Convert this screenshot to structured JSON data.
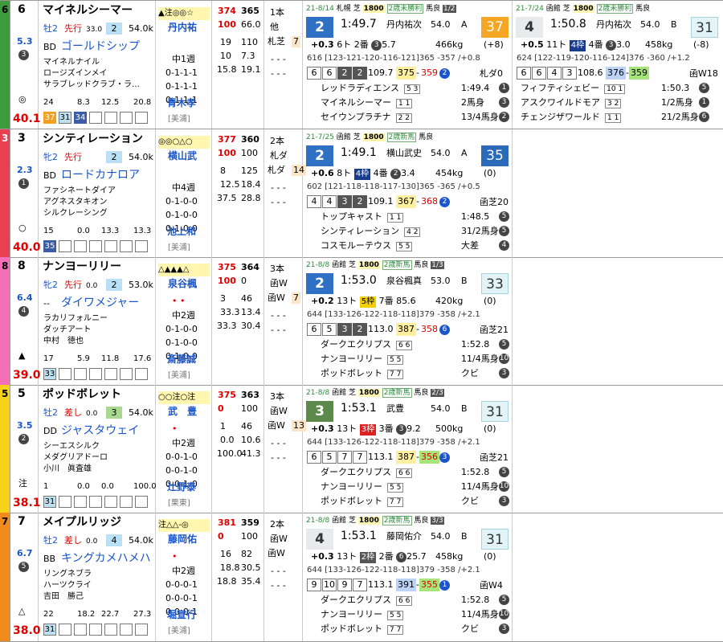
{
  "horses": [
    {
      "gate": "6",
      "gate_color": "#3d9b3d",
      "gate_text_color": "#000",
      "num": "6",
      "name": "マイネルシーマー",
      "sex": "牡2",
      "style": "先行",
      "style_val": "33.0",
      "pop": "2",
      "wt": "54.0k",
      "odds": "5.3",
      "pop_rank": "3",
      "bms_code": "BD",
      "sire": "ゴールドシップ",
      "dam": "マイネルナイル",
      "damsire": "ロージズインメイ",
      "owner": "サラブレッドクラブ・ラ…",
      "breeder": "",
      "mark": "◎",
      "score": "40.1",
      "pct1": "24",
      "pct2": "8.3",
      "pct3": "12.5",
      "pct4": "20.8",
      "past_pos": [
        "37",
        "31",
        "34",
        "",
        "",
        "",
        ""
      ],
      "marks": "▲注◎◎☆",
      "jockey": "丹内祐",
      "mid_dots": "",
      "rot": "中1週",
      "rec1": "0-1-1-1",
      "rec2": "0-1-1-1",
      "rec3": "0-1-1-1",
      "trainer": "青木孝",
      "stable": "[美浦]",
      "s1": "374",
      "s2": "365",
      "s3": "100",
      "s4": "66.0",
      "s5": "19",
      "s6": "110",
      "s7": "10",
      "s8": "7.3",
      "s9": "15.8",
      "s10": "19.1",
      "d1": "1本",
      "d2": "他",
      "d3": "札芝",
      "d4": "7",
      "d5": "- - -",
      "d6": "- - -",
      "races": [
        {
          "date": "21-8/14",
          "track": "札幌",
          "surf": "芝",
          "dist": "1800",
          "cls": "2歳未勝利",
          "cond": "馬良",
          "nn": "1/2",
          "rank": "2",
          "rank_style": "g",
          "time": "1:49.7",
          "jockey": "丹内祐次",
          "kg": "54.0",
          "grade": "A",
          "idx": "37",
          "idx_style": "or",
          "diff": "+0.3",
          "field": "6ト",
          "lot": "",
          "lot_style": "",
          "pop": "2番",
          "pop_circ": "3",
          "wt3": "5.7",
          "bw": "466kg",
          "bwd": "(+8)",
          "pace": "616 [123-121-120-116-121]365 -357 /+0.8",
          "cells": [
            "6",
            "6",
            "2",
            "2"
          ],
          "cdark": [
            false,
            false,
            true,
            true
          ],
          "rk": "109.7",
          "f1": "375",
          "f2": "359",
          "f2c": "2",
          "note": "札ダ0",
          "l1": "レッドラディエンス",
          "l1b": "5 3",
          "l1t": "1:49.4",
          "l1c": "1",
          "l2": "マイネルシーマー",
          "l2b": "1 1",
          "l2t": "2馬身",
          "l2c": "3",
          "l3": "セイウンプラチナ",
          "l3b": "2 2",
          "l3t": "13/4馬身",
          "l3c": "2"
        },
        {
          "date": "21-7/24",
          "track": "函館",
          "surf": "芝",
          "dist": "1800",
          "cls": "2歳未勝利",
          "cond": "馬良",
          "nn": "",
          "rank": "4",
          "rank_style": "w",
          "time": "1:50.8",
          "jockey": "丹内祐次",
          "kg": "54.0",
          "grade": "B",
          "idx": "31",
          "idx_style": "lb",
          "diff": "+0.5",
          "field": "11ト",
          "lot": "4枠",
          "lot_style": "nv",
          "pop": "4番",
          "pop_circ": "3",
          "wt3": "3.0",
          "bw": "458kg",
          "bwd": "(-8)",
          "pace": "624 [122-119-120-116-124]376 -360 /+1.2",
          "cells": [
            "6",
            "6",
            "4",
            "3"
          ],
          "cdark": [
            false,
            false,
            false,
            false
          ],
          "rk": "108.6",
          "f1": "376",
          "f2": "359",
          "f2c": "",
          "note": "函W18",
          "l1": "フィフティシェビー",
          "l1b": "10 1",
          "l1t": "1:50.3",
          "l1c": "5",
          "l2": "アスクワイルドモア",
          "l2b": "3 2",
          "l2t": "1/2馬身",
          "l2c": "1",
          "l3": "チェンジザワールド",
          "l3b": "1 1",
          "l3t": "21/2馬身",
          "l3c": "6"
        }
      ]
    },
    {
      "gate": "3",
      "gate_color": "#e84050",
      "gate_text_color": "#fff",
      "num": "3",
      "name": "シンティレーション",
      "sex": "牝2",
      "style": "先行",
      "style_val": "",
      "pop": "2",
      "wt": "54.0k",
      "odds": "2.3",
      "pop_rank": "1",
      "bms_code": "BD",
      "sire": "ロードカナロア",
      "dam": "ファシネートダイア",
      "damsire": "アグネスタキオン",
      "owner": "シルクレーシング",
      "breeder": "",
      "mark": "○",
      "score": "40.0",
      "pct1": "15",
      "pct2": "0.0",
      "pct3": "13.3",
      "pct4": "13.3",
      "past_pos": [
        "35",
        "",
        "",
        "",
        "",
        "",
        ""
      ],
      "marks": "◎◎○△○",
      "jockey": "横山武",
      "mid_dots": "",
      "rot": "中4週",
      "rec1": "0-1-0-0",
      "rec2": "0-1-0-0",
      "rec3": "0-1-0-0",
      "trainer": "池上和",
      "stable": "[美浦]",
      "s1": "377",
      "s2": "360",
      "s3": "100",
      "s4": "100",
      "s5": "8",
      "s6": "125",
      "s7": "12.5",
      "s8": "18.4",
      "s9": "37.5",
      "s10": "28.8",
      "d1": "2本",
      "d2": "札ダ",
      "d3": "札ダ",
      "d4": "14",
      "d5": "- - -",
      "d6": "- - -",
      "races": [
        {
          "date": "21-7/25",
          "track": "函館",
          "surf": "芝",
          "dist": "1800",
          "cls": "2歳新馬",
          "cond": "馬良",
          "nn": "",
          "rank": "2",
          "rank_style": "g",
          "time": "1:49.1",
          "jockey": "横山武史",
          "kg": "54.0",
          "grade": "A",
          "idx": "35",
          "idx_style": "nv",
          "diff": "+0.6",
          "field": "8ト",
          "lot": "4枠",
          "lot_style": "nv",
          "pop": "4番",
          "pop_circ": "2",
          "wt3": "3.4",
          "bw": "454kg",
          "bwd": "(0)",
          "pace": "602 [121-118-118-117-130]365 -365 /+0.5",
          "cells": [
            "4",
            "4",
            "3",
            "2"
          ],
          "cdark": [
            false,
            false,
            true,
            true
          ],
          "rk": "109.1",
          "f1": "367",
          "f2": "368",
          "f2c": "2",
          "note": "函芝20",
          "l1": "トップキャスト",
          "l1b": "1 1",
          "l1t": "1:48.5",
          "l1c": "5",
          "l2": "シンティレーション",
          "l2b": "4 2",
          "l2t": "31/2馬身",
          "l2c": "5",
          "l3": "コスモルーテウス",
          "l3b": "5 5",
          "l3t": "大差",
          "l3c": "4"
        },
        null
      ]
    },
    {
      "gate": "8",
      "gate_color": "#f46fb8",
      "gate_text_color": "#000",
      "num": "8",
      "name": "ナンヨーリリー",
      "sex": "牝2",
      "style": "先行",
      "style_val": "0.0",
      "pop": "2",
      "wt": "53.0k",
      "odds": "6.4",
      "pop_rank": "4",
      "bms_code": "--",
      "sire": "ダイワメジャー",
      "dam": "ラカリフォルニー",
      "damsire": "ダッチアート",
      "owner": "中村　徳也",
      "breeder": "",
      "mark": "▲",
      "score": "39.0",
      "pct1": "17",
      "pct2": "5.9",
      "pct3": "11.8",
      "pct4": "17.6",
      "past_pos": [
        "33",
        "",
        "",
        "",
        "",
        "",
        ""
      ],
      "marks": "△▲▲▲△",
      "jockey": "泉谷楓",
      "mid_dots": "• •",
      "rot": "中2週",
      "rec1": "0-1-0-0",
      "rec2": "0-1-0-0",
      "rec3": "0-1-0-0",
      "trainer": "斎藤誠",
      "stable": "[美浦]",
      "s1": "375",
      "s2": "364",
      "s3": "100",
      "s4": "0",
      "s5": "3",
      "s6": "46",
      "s7": "33.3",
      "s8": "13.4",
      "s9": "33.3",
      "s10": "30.4",
      "d1": "3本",
      "d2": "函W",
      "d3": "函W",
      "d4": "7",
      "d5": "- - -",
      "d6": "- - -",
      "races": [
        {
          "date": "21-8/8",
          "track": "函館",
          "surf": "芝",
          "dist": "1800",
          "cls": "2歳新馬",
          "cond": "馬良",
          "nn": "1/3",
          "rank": "2",
          "rank_style": "g",
          "time": "1:53.0",
          "jockey": "泉谷楓真",
          "kg": "53.0",
          "grade": "B",
          "idx": "33",
          "idx_style": "lb",
          "diff": "+0.2",
          "field": "13ト",
          "lot": "5枠",
          "lot_style": "yl",
          "pop": "7番",
          "pop_circ": "",
          "wt3": "85.6",
          "bw": "420kg",
          "bwd": "(0)",
          "pace": "644 [133-126-122-118-118]379 -358 /+2.1",
          "cells": [
            "6",
            "5",
            "3",
            "2"
          ],
          "cdark": [
            false,
            false,
            true,
            true
          ],
          "rk": "113.0",
          "f1": "387",
          "f2": "358",
          "f2c": "6",
          "note": "函芝21",
          "l1": "ダークエクリプス",
          "l1b": "6 6",
          "l1t": "1:52.8",
          "l1c": "5",
          "l2": "ナンヨーリリー",
          "l2b": "5 5",
          "l2t": "11/4馬身",
          "l2c": "10",
          "l3": "ポッドボレット",
          "l3b": "7 7",
          "l3t": "クビ",
          "l3c": "3"
        },
        null
      ]
    },
    {
      "gate": "5",
      "gate_color": "#f7d21a",
      "gate_text_color": "#000",
      "num": "5",
      "name": "ポッドボレット",
      "sex": "牡2",
      "style": "差し",
      "style_val": "0.0",
      "pop": "3",
      "wt": "54.0k",
      "odds": "3.5",
      "pop_rank": "2",
      "bms_code": "DD",
      "sire": "ジャスタウェイ",
      "dam": "シーエスシルク",
      "damsire": "メダグリアドーロ",
      "owner": "小川　眞査雄",
      "breeder": "",
      "mark": "注",
      "score": "38.1",
      "pct1": "1",
      "pct2": "0.0",
      "pct3": "0.0",
      "pct4": "100.0",
      "past_pos": [
        "31",
        "",
        "",
        "",
        "",
        "",
        ""
      ],
      "marks": "○○注○注",
      "jockey": "武　豊",
      "mid_dots": "•",
      "rot": "中2週",
      "rec1": "0-0-1-0",
      "rec2": "0-0-1-0",
      "rec3": "0-0-1-0",
      "trainer": "辻野泰",
      "stable": "[栗東]",
      "s1": "375",
      "s2": "363",
      "s3": "0",
      "s4": "100",
      "s5": "1",
      "s6": "46",
      "s7": "0.0",
      "s8": "10.6",
      "s9": "100.0",
      "s10": "41.3",
      "d1": "3本",
      "d2": "函W",
      "d3": "函W",
      "d4": "13",
      "d5": "- - -",
      "d6": "- - -",
      "races": [
        {
          "date": "21-8/8",
          "track": "函館",
          "surf": "芝",
          "dist": "1800",
          "cls": "2歳新馬",
          "cond": "馬良",
          "nn": "2/3",
          "rank": "3",
          "rank_style": "gr",
          "time": "1:53.1",
          "jockey": "武豊",
          "kg": "54.0",
          "grade": "B",
          "idx": "31",
          "idx_style": "lb",
          "diff": "+0.3",
          "field": "13ト",
          "lot": "3枠",
          "lot_style": "rd",
          "pop": "3番",
          "pop_circ": "3",
          "wt3": "9.2",
          "bw": "500kg",
          "bwd": "(0)",
          "pace": "644 [133-126-122-118-118]379 -358 /+2.1",
          "cells": [
            "6",
            "5",
            "7",
            "7"
          ],
          "cdark": [
            false,
            false,
            false,
            false
          ],
          "rk": "113.1",
          "f1": "387",
          "f2": "356",
          "f2c": "3",
          "note": "函芝21",
          "l1": "ダークエクリプス",
          "l1b": "6 6",
          "l1t": "1:52.8",
          "l1c": "5",
          "l2": "ナンヨーリリー",
          "l2b": "5 5",
          "l2t": "11/4馬身",
          "l2c": "10",
          "l3": "ポッドボレット",
          "l3b": "7 7",
          "l3t": "クビ",
          "l3c": "3"
        },
        null
      ]
    },
    {
      "gate": "7",
      "gate_color": "#f38a1c",
      "gate_text_color": "#000",
      "num": "7",
      "name": "メイプルリッジ",
      "sex": "牡2",
      "style": "差し",
      "style_val": "0.0",
      "pop": "4",
      "wt": "54.0k",
      "odds": "6.7",
      "pop_rank": "5",
      "bms_code": "BB",
      "sire": "キングカメハメハ",
      "dam": "リングネブラ",
      "damsire": "ハーツクライ",
      "owner": "吉田　勝己",
      "breeder": "",
      "mark": "△",
      "score": "38.0",
      "pct1": "22",
      "pct2": "18.2",
      "pct3": "22.7",
      "pct4": "27.3",
      "past_pos": [
        "31",
        "",
        "",
        "",
        "",
        "",
        ""
      ],
      "marks": "注△△-◎",
      "jockey": "藤岡佑",
      "mid_dots": "•",
      "rot": "中2週",
      "rec1": "0-0-0-1",
      "rec2": "0-0-0-1",
      "rec3": "0-0-0-1",
      "trainer": "堀宣行",
      "stable": "[美浦]",
      "s1": "381",
      "s2": "359",
      "s3": "0",
      "s4": "100",
      "s5": "16",
      "s6": "82",
      "s7": "18.8",
      "s8": "30.5",
      "s9": "18.8",
      "s10": "35.4",
      "d1": "2本",
      "d2": "函W",
      "d3": "函W",
      "d4": "",
      "d5": "- - -",
      "d6": "- - -",
      "races": [
        {
          "date": "21-8/8",
          "track": "函館",
          "surf": "芝",
          "dist": "1800",
          "cls": "2歳新馬",
          "cond": "馬良",
          "nn": "3/3",
          "rank": "4",
          "rank_style": "w",
          "time": "1:53.1",
          "jockey": "藤岡佑介",
          "kg": "54.0",
          "grade": "B",
          "idx": "31",
          "idx_style": "lb",
          "diff": "+0.3",
          "field": "13ト",
          "lot": "2枠",
          "lot_style": "gr",
          "pop": "2番",
          "pop_circ": "6",
          "wt3": "25.7",
          "bw": "458kg",
          "bwd": "(0)",
          "pace": "644 [133-126-122-118-118]379 -358 /+2.1",
          "cells": [
            "9",
            "10",
            "9",
            "7"
          ],
          "cdark": [
            false,
            false,
            false,
            false
          ],
          "rk": "113.1",
          "f1": "391",
          "f2": "355",
          "f2c": "1",
          "note": "函W4",
          "l1": "ダークエクリプス",
          "l1b": "6 6",
          "l1t": "1:52.8",
          "l1c": "5",
          "l2": "ナンヨーリリー",
          "l2b": "5 5",
          "l2t": "11/4馬身",
          "l2c": "10",
          "l3": "ポッドボレット",
          "l3b": "7 7",
          "l3t": "クビ",
          "l3c": "3"
        },
        null
      ]
    }
  ]
}
